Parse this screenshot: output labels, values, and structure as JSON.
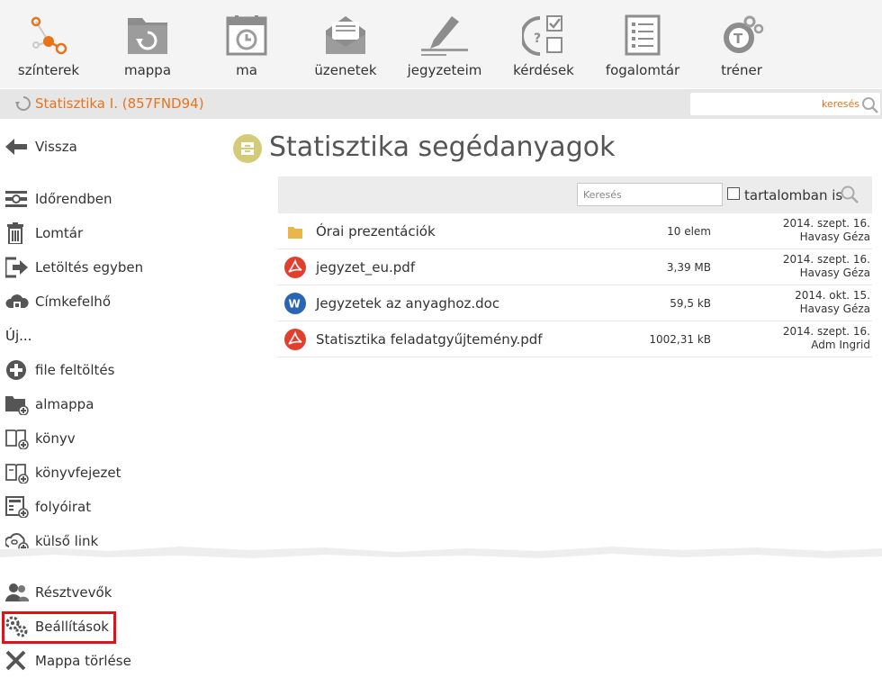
{
  "toolbar": {
    "items": [
      {
        "label": "színterek",
        "icon": "network-icon"
      },
      {
        "label": "mappa",
        "icon": "folder-refresh-icon"
      },
      {
        "label": "ma",
        "icon": "calendar-clock-icon"
      },
      {
        "label": "üzenetek",
        "icon": "envelope-icon"
      },
      {
        "label": "jegyzeteim",
        "icon": "pencil-icon"
      },
      {
        "label": "kérdések",
        "icon": "quiz-icon"
      },
      {
        "label": "fogalomtár",
        "icon": "glossary-icon"
      },
      {
        "label": "tréner",
        "icon": "trainer-icon"
      }
    ]
  },
  "breadcrumb": {
    "text": "Statisztika I. (857FND94)"
  },
  "top_search": {
    "placeholder": "keresés"
  },
  "sidebar": {
    "back": "Vissza",
    "items": [
      {
        "label": "Időrendben",
        "icon": "timeline-icon"
      },
      {
        "label": "Lomtár",
        "icon": "trash-icon"
      },
      {
        "label": "Letöltés egyben",
        "icon": "download-export-icon"
      },
      {
        "label": "Címkefelhő",
        "icon": "tag-cloud-icon"
      }
    ],
    "new_heading": "Új...",
    "new_items": [
      {
        "label": "file feltöltés",
        "icon": "plus-circle-icon"
      },
      {
        "label": "almappa",
        "icon": "subfolder-add-icon"
      },
      {
        "label": "könyv",
        "icon": "book-add-icon"
      },
      {
        "label": "könyvfejezet",
        "icon": "chapter-add-icon"
      },
      {
        "label": "folyóirat",
        "icon": "journal-add-icon"
      },
      {
        "label": "külső link",
        "icon": "link-add-icon"
      }
    ],
    "bottom_items": [
      {
        "label": "Résztvevők",
        "icon": "participants-icon"
      },
      {
        "label": "Beállítások",
        "icon": "settings-gears-icon"
      },
      {
        "label": "Mappa törlése",
        "icon": "delete-x-icon"
      }
    ]
  },
  "main": {
    "title": "Statisztika segédanyagok",
    "list_search_placeholder": "Keresés",
    "content_checkbox_label": "tartalomban is",
    "rows": [
      {
        "name": "Órai prezentációk",
        "size": "10 elem",
        "date": "2014. szept. 16.",
        "author": "Havasy Géza",
        "type": "folder"
      },
      {
        "name": "jegyzet_eu.pdf",
        "size": "3,39 MB",
        "date": "2014. szept. 16.",
        "author": "Havasy Géza",
        "type": "pdf"
      },
      {
        "name": "Jegyzetek az anyaghoz.doc",
        "size": "59,5 kB",
        "date": "2014. okt. 15.",
        "author": "Havasy Géza",
        "type": "word"
      },
      {
        "name": "Statisztika feladatgyűjtemény.pdf",
        "size": "1002,31 kB",
        "date": "2014. szept. 16.",
        "author": "Adm Ingrid",
        "type": "pdf"
      }
    ]
  },
  "colors": {
    "accent": "#e7741b",
    "pdf": "#e2402c",
    "word": "#2a65b3",
    "folder": "#e9b64b",
    "highlight": "#e0111b",
    "title_icon": "#d4cb78"
  }
}
